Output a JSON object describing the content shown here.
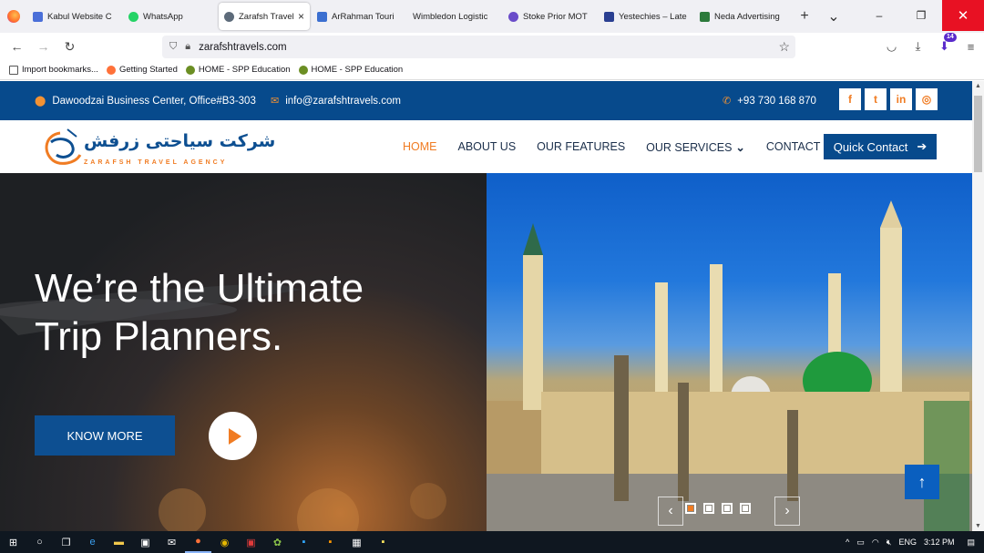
{
  "browser": {
    "tabs": [
      {
        "label": "Kabul Website C",
        "color": "#4a6fd8",
        "active": false
      },
      {
        "label": "WhatsApp",
        "color": "#25d366",
        "active": false
      },
      {
        "label": "Zarafsh Travel",
        "color": "#5d6b7a",
        "active": true
      },
      {
        "label": "ArRahman Touri",
        "color": "#3b6fd0",
        "active": false
      },
      {
        "label": "Wimbledon Logistic",
        "color": "",
        "active": false
      },
      {
        "label": "Stoke Prior MOT",
        "color": "#6a4cc9",
        "active": false
      },
      {
        "label": "Yestechies – Late",
        "color": "#2a3f91",
        "active": false
      },
      {
        "label": "Neda Advertising",
        "color": "#2c7a3b",
        "active": false
      }
    ],
    "tab_close": "×",
    "new_tab": "+",
    "tab_list": "⌄",
    "window": {
      "minimize": "–",
      "restore": "❐",
      "close": "✕"
    },
    "nav": {
      "back": "←",
      "forward": "→",
      "reload": "↻"
    },
    "url": "zarafshtravels.com",
    "notification_count": "14",
    "bookmarks": [
      {
        "label": "Import bookmarks...",
        "color": "#555"
      },
      {
        "label": "Getting Started",
        "color": "#ff7139"
      },
      {
        "label": "HOME - SPP Education",
        "color": "#6b8e23"
      },
      {
        "label": "HOME - SPP Education",
        "color": "#6b8e23"
      }
    ]
  },
  "site": {
    "address": "Dawoodzai Business Center, Office#B3-303",
    "email": "info@zarafshtravels.com",
    "phone": "+93 730 168 870",
    "social": [
      "f",
      "t",
      "in",
      "◎"
    ],
    "logo": {
      "arabic": "شرکت سیاحتی زرفش",
      "english": "ZARAFSH TRAVEL AGENCY"
    },
    "menu": [
      "HOME",
      "ABOUT US",
      "OUR FEATURES",
      "OUR SERVICES",
      "CONTACT US"
    ],
    "services_caret": "⌄",
    "quick_contact": "Quick Contact",
    "quick_arrow": "➔",
    "hero": {
      "headline_line1": "We’re the Ultimate",
      "headline_line2": "Trip Planners.",
      "cta": "KNOW MORE",
      "prev": "‹",
      "next": "›"
    },
    "back_to_top": "↑"
  },
  "taskbar": {
    "time": "3:12 PM",
    "lang": "ENG"
  },
  "colors": {
    "brand_blue": "#074a8c",
    "accent_orange": "#f07c23"
  }
}
